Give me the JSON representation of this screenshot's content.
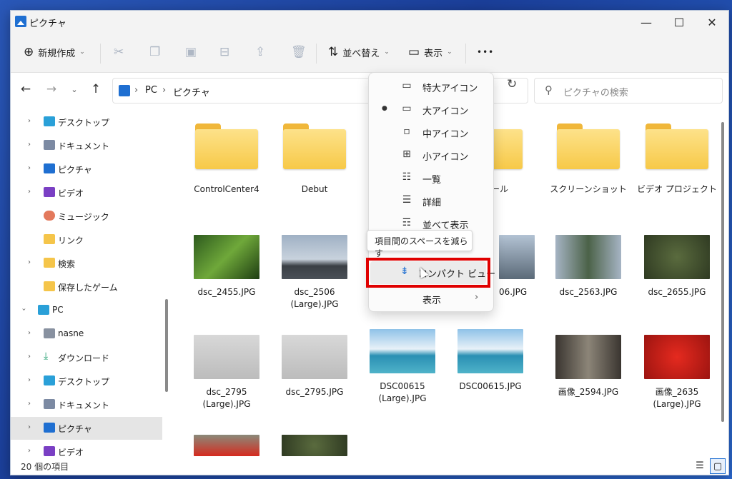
{
  "window": {
    "title": "ピクチャ"
  },
  "titlebar": {
    "minimize": "—",
    "maximize": "☐",
    "close": "✕"
  },
  "toolbar": {
    "new_label": "新規作成",
    "sort_label": "並べ替え",
    "view_label": "表示",
    "more_label": "•••"
  },
  "address": {
    "segments": [
      "PC",
      "ピクチャ"
    ]
  },
  "search": {
    "placeholder": "ピクチャの検索"
  },
  "sidebar": {
    "items": [
      {
        "label": "デスクトップ",
        "icon": "desktop-icon"
      },
      {
        "label": "ドキュメント",
        "icon": "document-icon"
      },
      {
        "label": "ピクチャ",
        "icon": "pictures-icon"
      },
      {
        "label": "ビデオ",
        "icon": "video-icon"
      },
      {
        "label": "ミュージック",
        "icon": "music-icon"
      },
      {
        "label": "リンク",
        "icon": "folder-icon"
      },
      {
        "label": "検索",
        "icon": "folder-icon"
      },
      {
        "label": "保存したゲーム",
        "icon": "folder-icon"
      },
      {
        "label": "PC",
        "icon": "pc-icon"
      },
      {
        "label": "nasne",
        "icon": "network-drive-icon"
      },
      {
        "label": "ダウンロード",
        "icon": "download-icon"
      },
      {
        "label": "デスクトップ",
        "icon": "desktop-icon"
      },
      {
        "label": "ドキュメント",
        "icon": "document-icon"
      },
      {
        "label": "ピクチャ",
        "icon": "pictures-icon"
      },
      {
        "label": "ビデオ",
        "icon": "video-icon"
      }
    ]
  },
  "files": [
    {
      "name": "ControlCenter4",
      "type": "folder"
    },
    {
      "name": "Debut",
      "type": "folder"
    },
    {
      "name": "コール",
      "type": "folder"
    },
    {
      "name": "スクリーンショット",
      "type": "folder"
    },
    {
      "name": "ビデオ プロジェクト",
      "type": "folder"
    },
    {
      "name": "dsc_2455.JPG",
      "type": "photo"
    },
    {
      "name": "dsc_2506 (Large).JPG",
      "type": "photo"
    },
    {
      "name": "06.JPG",
      "type": "photo"
    },
    {
      "name": "dsc_2563.JPG",
      "type": "photo"
    },
    {
      "name": "dsc_2655.JPG",
      "type": "photo"
    },
    {
      "name": "dsc_2795 (Large).JPG",
      "type": "photo"
    },
    {
      "name": "dsc_2795.JPG",
      "type": "photo"
    },
    {
      "name": "DSC00615 (Large).JPG",
      "type": "photo"
    },
    {
      "name": "DSC00615.JPG",
      "type": "photo"
    },
    {
      "name": "画像_2594.JPG",
      "type": "photo"
    },
    {
      "name": "画像_2635 (Large).JPG",
      "type": "photo"
    }
  ],
  "view_menu": {
    "items": [
      {
        "label": "特大アイコン",
        "icon": "extra-large-icons-icon",
        "selected": false
      },
      {
        "label": "大アイコン",
        "icon": "large-icons-icon",
        "selected": true
      },
      {
        "label": "中アイコン",
        "icon": "medium-icons-icon",
        "selected": false
      },
      {
        "label": "小アイコン",
        "icon": "small-icons-icon",
        "selected": false
      },
      {
        "label": "一覧",
        "icon": "list-icon",
        "selected": false
      },
      {
        "label": "詳細",
        "icon": "details-icon",
        "selected": false
      },
      {
        "label": "並べて表示",
        "icon": "tiles-icon",
        "selected": false
      }
    ],
    "compact_label": "コンパクト ビュー",
    "show_label": "表示",
    "tooltip": "項目間のスペースを減らす"
  },
  "status": {
    "count": "20 個の項目"
  },
  "colors": {
    "highlight": "#e00000",
    "accent": "#1f6fd1",
    "folder": "#f7c948"
  }
}
